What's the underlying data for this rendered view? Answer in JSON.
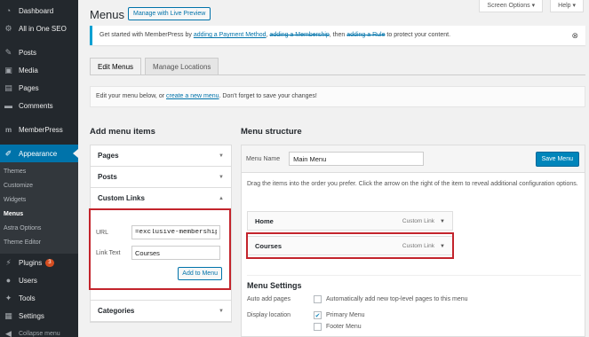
{
  "sidebar": {
    "items": [
      {
        "label": "Dashboard",
        "icon": "dashboard-icon"
      },
      {
        "label": "All in One SEO",
        "icon": "seo-gear-icon"
      },
      {
        "label": "Posts",
        "icon": "pin-icon"
      },
      {
        "label": "Media",
        "icon": "media-icon"
      },
      {
        "label": "Pages",
        "icon": "page-icon"
      },
      {
        "label": "Comments",
        "icon": "comment-icon"
      },
      {
        "label": "MemberPress",
        "icon": "memberpress-icon"
      },
      {
        "label": "Appearance",
        "icon": "brush-icon"
      },
      {
        "label": "Plugins",
        "icon": "plug-icon",
        "badge": "3"
      },
      {
        "label": "Users",
        "icon": "user-icon"
      },
      {
        "label": "Tools",
        "icon": "wrench-icon"
      },
      {
        "label": "Settings",
        "icon": "settings-icon"
      },
      {
        "label": "Collapse menu",
        "icon": "collapse-icon"
      }
    ],
    "submenu": [
      "Themes",
      "Customize",
      "Widgets",
      "Menus",
      "Astra Options",
      "Theme Editor"
    ],
    "active_submenu": "Menus"
  },
  "top_tabs": {
    "screen_options": "Screen Options ▾",
    "help": "Help ▾"
  },
  "page": {
    "title": "Menus",
    "live_preview": "Manage with Live Preview"
  },
  "notice": {
    "prefix": "Get started with MemberPress by",
    "link1": "adding a Payment Method",
    "sep1": ",",
    "link2": "adding a Membership",
    "sep2": ", then",
    "link3": "adding a Rule",
    "suffix": "to protect your content."
  },
  "tabs": {
    "edit": "Edit Menus",
    "locations": "Manage Locations"
  },
  "edit_box": {
    "prefix": "Edit your menu below, or",
    "link": "create a new menu",
    "suffix": ". Don't forget to save your changes!"
  },
  "add_items": {
    "title": "Add menu items",
    "pages": "Pages",
    "posts": "Posts",
    "custom_links": "Custom Links",
    "url_label": "URL",
    "url_value": "=exclusive-membership",
    "text_label": "Link Text",
    "text_value": "Courses",
    "add_button": "Add to Menu",
    "categories": "Categories"
  },
  "structure": {
    "title": "Menu structure",
    "name_label": "Menu Name",
    "name_value": "Main Menu",
    "save": "Save Menu",
    "desc": "Drag the items into the order you prefer. Click the arrow on the right of the item to reveal additional configuration options.",
    "items": [
      {
        "label": "Home",
        "type": "Custom Link"
      },
      {
        "label": "Courses",
        "type": "Custom Link"
      }
    ],
    "settings_title": "Menu Settings",
    "auto_add_label": "Auto add pages",
    "auto_add_option": "Automatically add new top-level pages to this menu",
    "location_label": "Display location",
    "location_primary": "Primary Menu",
    "location_footer": "Footer Menu"
  },
  "colors": {
    "sidebar_bg": "#23282d",
    "accent": "#0073aa",
    "highlight": "#c3242c"
  }
}
